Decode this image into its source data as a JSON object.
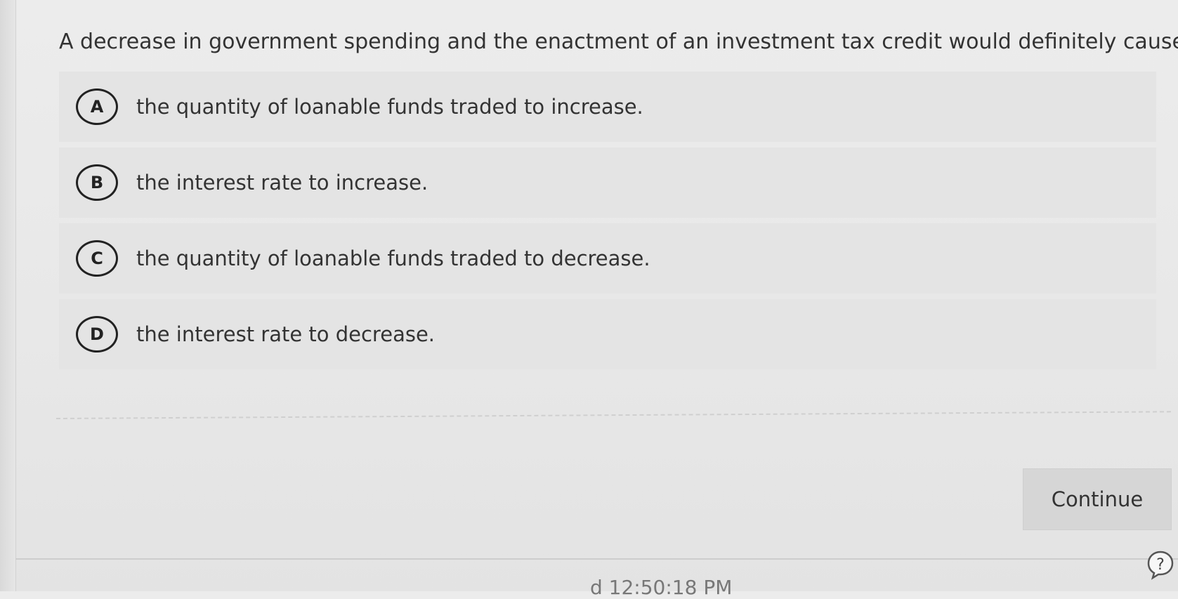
{
  "question": {
    "text": "A decrease in government spending and the enactment of an investment tax credit would definitely cause"
  },
  "choices": [
    {
      "letter": "A",
      "text": "the quantity of loanable funds traded to increase."
    },
    {
      "letter": "B",
      "text": "the interest rate to increase."
    },
    {
      "letter": "C",
      "text": "the quantity of loanable funds traded to decrease."
    },
    {
      "letter": "D",
      "text": "the interest rate to decrease."
    }
  ],
  "actions": {
    "continue_label": "Continue"
  },
  "footer": {
    "partial_time_text": "d 12:50:18 PM"
  },
  "icons": {
    "help": "help-question-icon"
  }
}
